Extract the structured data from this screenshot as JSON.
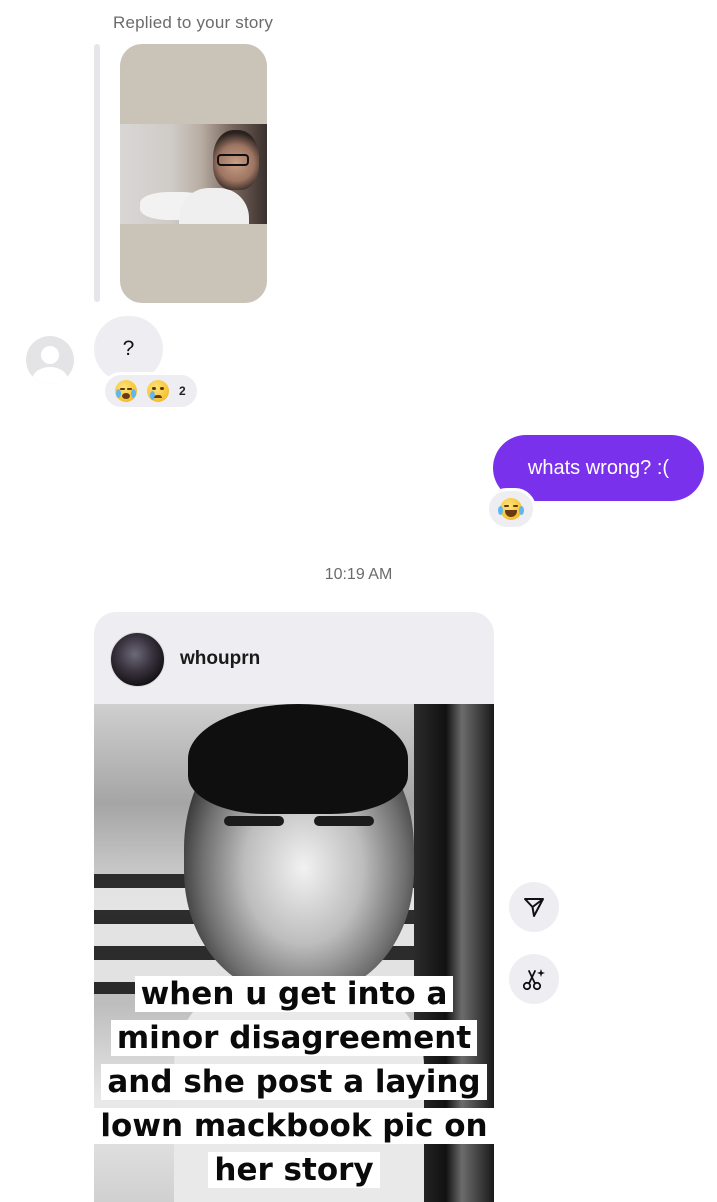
{
  "story_reply": {
    "label": "Replied to your story"
  },
  "incoming_message": {
    "text": "?",
    "reactions": [
      "loudly-crying-face",
      "crying-face"
    ],
    "reaction_count": "2"
  },
  "outgoing_message": {
    "text": "whats wrong? :(",
    "reaction": "face-with-tears-of-joy",
    "bubble_color": "#7a31ec"
  },
  "timestamp": "10:19 AM",
  "shared_post": {
    "username": "whouprn",
    "caption_lines": [
      "when u get into a",
      "minor disagreement",
      "and she post a laying",
      "lown mackbook pic on",
      "her story"
    ]
  },
  "actions": {
    "share_icon": "share-icon",
    "remix_icon": "scissors-sparkle-icon"
  }
}
